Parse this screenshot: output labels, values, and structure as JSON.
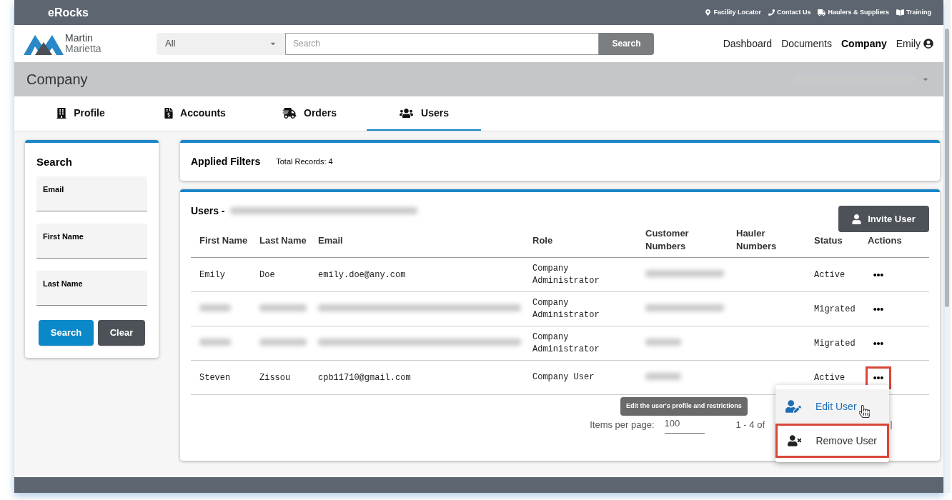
{
  "top_bar": {
    "brand": "eRocks",
    "links": [
      {
        "kind": "pin",
        "label": "Facility Locator"
      },
      {
        "kind": "phone",
        "label": "Contact Us"
      },
      {
        "kind": "truck",
        "label": "Haulers & Suppliers"
      },
      {
        "kind": "book",
        "label": "Training"
      }
    ]
  },
  "header": {
    "logo": {
      "line1": "Martin",
      "line2": "Marietta"
    },
    "category": "All",
    "search_placeholder": "Search",
    "search_button": "Search",
    "nav": [
      {
        "label": "Dashboard",
        "selected": false
      },
      {
        "label": "Documents",
        "selected": false
      },
      {
        "label": "Company",
        "selected": true
      }
    ],
    "user": "Emily"
  },
  "page_title": "Company",
  "tabs": [
    {
      "kind": "building",
      "label": "Profile",
      "selected": false
    },
    {
      "kind": "invoice",
      "label": "Accounts",
      "selected": false
    },
    {
      "kind": "truck",
      "label": "Orders",
      "selected": false
    },
    {
      "kind": "users",
      "label": "Users",
      "selected": true
    }
  ],
  "search_panel": {
    "title": "Search",
    "fields": [
      {
        "label": "Email"
      },
      {
        "label": "First Name"
      },
      {
        "label": "Last Name"
      }
    ],
    "search_button": "Search",
    "clear_button": "Clear"
  },
  "filters": {
    "title": "Applied Filters",
    "total": "Total Records: 4"
  },
  "users": {
    "title": "Users -",
    "invite_button": "Invite User",
    "columns": [
      "First Name",
      "Last Name",
      "Email",
      "Role",
      "Customer Numbers",
      "Hauler Numbers",
      "Status",
      "Actions"
    ],
    "rows": [
      {
        "first_name": "Emily",
        "last_name": "Doe",
        "email": "emily.doe@any.com",
        "role": "Company Administrator",
        "status": "Active",
        "highlighted": false
      },
      {
        "role": "Company Administrator",
        "status": "Migrated",
        "highlighted": false
      },
      {
        "role": "Company Administrator",
        "status": "Migrated",
        "highlighted": false
      },
      {
        "first_name": "Steven",
        "last_name": "Zissou",
        "email": "cpb11710@gmail.com",
        "role": "Company User",
        "status": "Active",
        "highlighted": true
      }
    ],
    "pagination": {
      "label": "Items per page:",
      "page_size": "100",
      "range": "1 - 4 of"
    }
  },
  "tooltip": "Edit the user's profile and restrictions",
  "menu": [
    {
      "kind": "edit",
      "label": "Edit User",
      "hovered": true,
      "highlighted": false
    },
    {
      "kind": "remove",
      "label": "Remove User",
      "hovered": false,
      "highlighted": true
    }
  ]
}
